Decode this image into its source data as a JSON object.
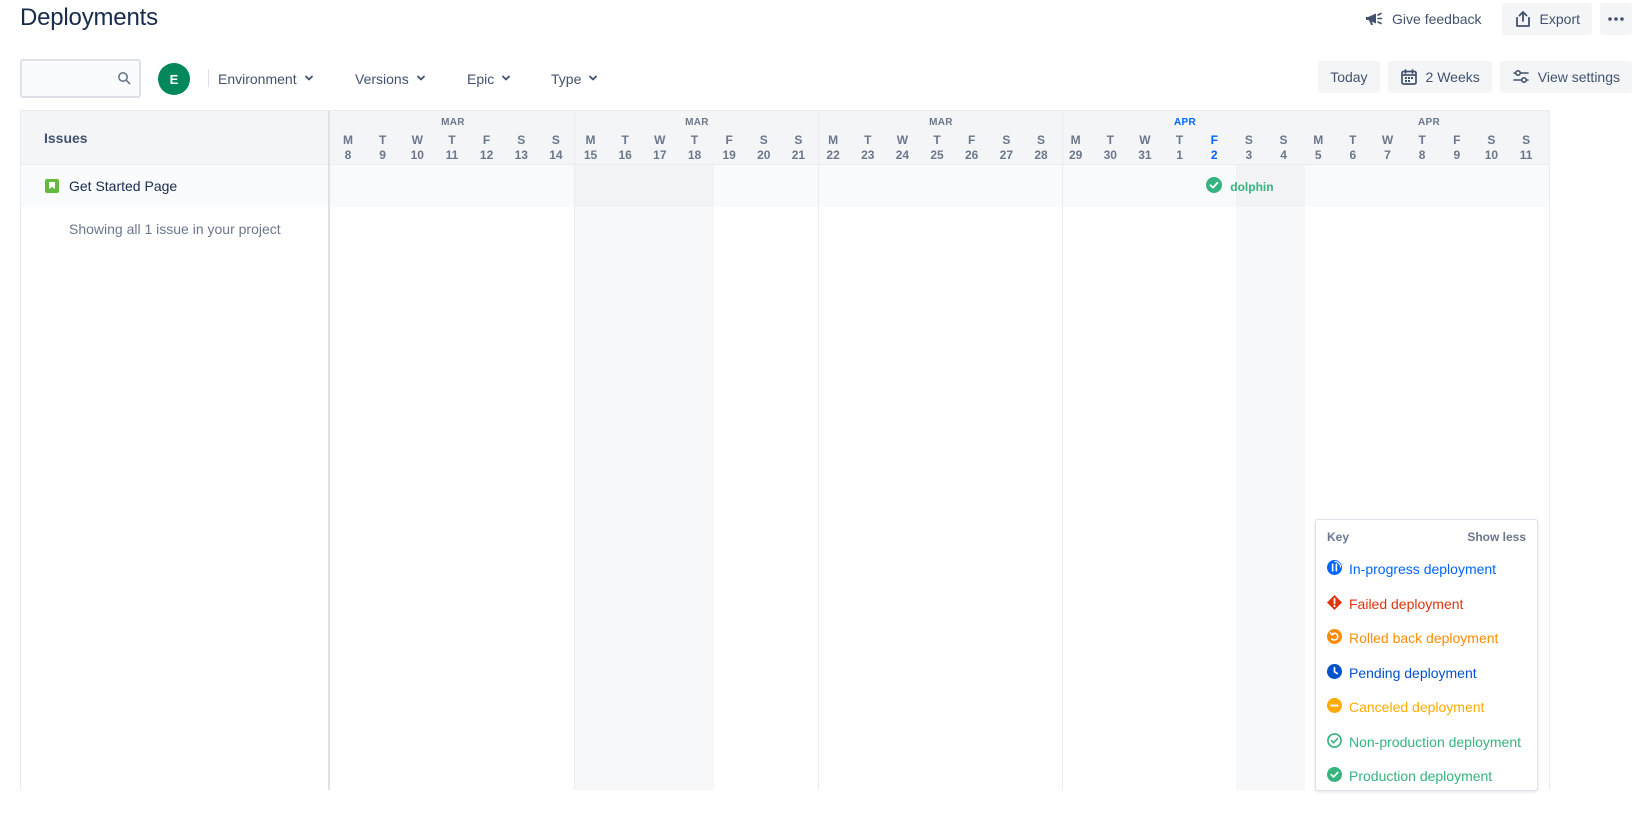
{
  "header": {
    "title": "Deployments",
    "give_feedback": "Give feedback",
    "export": "Export"
  },
  "filters": {
    "search_placeholder": "",
    "avatar_initial": "E",
    "environment": "Environment",
    "versions": "Versions",
    "epic": "Epic",
    "type": "Type",
    "today": "Today",
    "range": "2 Weeks",
    "view_settings": "View settings"
  },
  "issues": {
    "header": "Issues",
    "rows": [
      {
        "title": "Get Started Page"
      }
    ],
    "summary": "Showing all 1 issue in your project"
  },
  "timeline": {
    "months": [
      {
        "label": "MAR",
        "current": false
      },
      {
        "label": "MAR",
        "current": false
      },
      {
        "label": "MAR",
        "current": false
      },
      {
        "label": "APR",
        "current": true
      },
      {
        "label": "APR",
        "current": false
      }
    ],
    "days": [
      {
        "dow": "M",
        "num": "8"
      },
      {
        "dow": "T",
        "num": "9"
      },
      {
        "dow": "W",
        "num": "10"
      },
      {
        "dow": "T",
        "num": "11"
      },
      {
        "dow": "F",
        "num": "12"
      },
      {
        "dow": "S",
        "num": "13"
      },
      {
        "dow": "S",
        "num": "14"
      },
      {
        "dow": "M",
        "num": "15"
      },
      {
        "dow": "T",
        "num": "16"
      },
      {
        "dow": "W",
        "num": "17"
      },
      {
        "dow": "T",
        "num": "18"
      },
      {
        "dow": "F",
        "num": "19"
      },
      {
        "dow": "S",
        "num": "20"
      },
      {
        "dow": "S",
        "num": "21"
      },
      {
        "dow": "M",
        "num": "22"
      },
      {
        "dow": "T",
        "num": "23"
      },
      {
        "dow": "W",
        "num": "24"
      },
      {
        "dow": "T",
        "num": "25"
      },
      {
        "dow": "F",
        "num": "26"
      },
      {
        "dow": "S",
        "num": "27"
      },
      {
        "dow": "S",
        "num": "28"
      },
      {
        "dow": "M",
        "num": "29"
      },
      {
        "dow": "T",
        "num": "30"
      },
      {
        "dow": "W",
        "num": "31"
      },
      {
        "dow": "T",
        "num": "1"
      },
      {
        "dow": "F",
        "num": "2",
        "today": true
      },
      {
        "dow": "S",
        "num": "3"
      },
      {
        "dow": "S",
        "num": "4"
      },
      {
        "dow": "M",
        "num": "5"
      },
      {
        "dow": "T",
        "num": "6"
      },
      {
        "dow": "W",
        "num": "7"
      },
      {
        "dow": "T",
        "num": "8"
      },
      {
        "dow": "F",
        "num": "9"
      },
      {
        "dow": "S",
        "num": "10"
      },
      {
        "dow": "S",
        "num": "11"
      }
    ],
    "deployment": {
      "label": "dolphin",
      "status": "production",
      "day_index": 25
    }
  },
  "legend": {
    "title": "Key",
    "toggle": "Show less",
    "items": [
      {
        "label": "In-progress deployment",
        "icon": "in-progress-icon",
        "color": "#0065FF"
      },
      {
        "label": "Failed deployment",
        "icon": "failed-icon",
        "color": "#DE350B"
      },
      {
        "label": "Rolled back deployment",
        "icon": "rolled-back-icon",
        "color": "#FF8B00"
      },
      {
        "label": "Pending deployment",
        "icon": "pending-icon",
        "color": "#0052CC"
      },
      {
        "label": "Canceled deployment",
        "icon": "canceled-icon",
        "color": "#FFAB00"
      },
      {
        "label": "Non-production deployment",
        "icon": "non-production-icon",
        "color": "#36B37E"
      },
      {
        "label": "Production deployment",
        "icon": "production-icon",
        "color": "#36B37E"
      }
    ]
  },
  "colors": {
    "accent": "#0065FF",
    "avatar": "#00875A",
    "success": "#36B37E",
    "text_primary": "#172B4D",
    "text_subtle": "#6B778C"
  }
}
